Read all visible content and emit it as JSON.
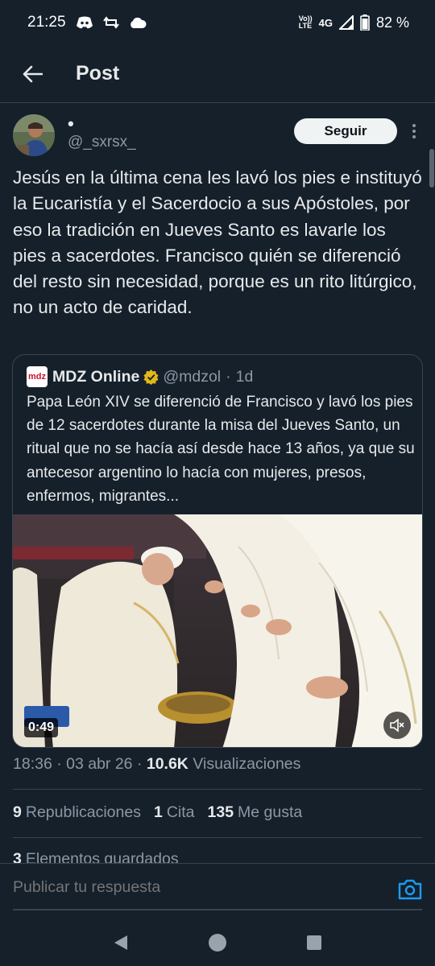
{
  "status_bar": {
    "time": "21:25",
    "network": "4G",
    "volte_top": "Vo))",
    "volte_bottom": "LTE",
    "battery": "82 %"
  },
  "header": {
    "title": "Post"
  },
  "post": {
    "author_name": "•",
    "author_handle": "@_sxrsx_",
    "follow_label": "Seguir",
    "text": "Jesús en la última cena les lavó los pies e instituyó la Eucaristía y el Sacerdocio a sus Apóstoles, por eso la tradición en Jueves Santo es lavarle los pies a sacerdotes. Francisco quién se diferenció del resto sin necesidad, porque es un rito litúrgico, no un acto de caridad.",
    "timestamp": "18:36 · 03 abr 26 ·",
    "views_count": "10.6K",
    "views_label": "Visualizaciones"
  },
  "quote": {
    "logo_text": "mdz",
    "name": "MDZ Online",
    "handle": "@mdzol",
    "dot": "·",
    "time": "1d",
    "text": "Papa León XIV se diferenció de Francisco y lavó los pies de 12 sacerdotes durante la misa del Jueves Santo, un ritual que no se hacía así desde hace 13 años, ya que su antecesor argentino lo hacía con mujeres, presos, enfermos, migrantes...",
    "video_duration": "0:49"
  },
  "stats": {
    "reposts_count": "9",
    "reposts_label": "Republicaciones",
    "quotes_count": "1",
    "quotes_label": "Cita",
    "likes_count": "135",
    "likes_label": "Me gusta",
    "bookmarks_count": "3",
    "bookmarks_label": "Elementos guardados"
  },
  "reply": {
    "placeholder": "Publicar tu respuesta"
  },
  "colors": {
    "background": "#15202b",
    "accent": "#1d9bf0",
    "muted": "#8b98a5",
    "border": "#38444d"
  }
}
